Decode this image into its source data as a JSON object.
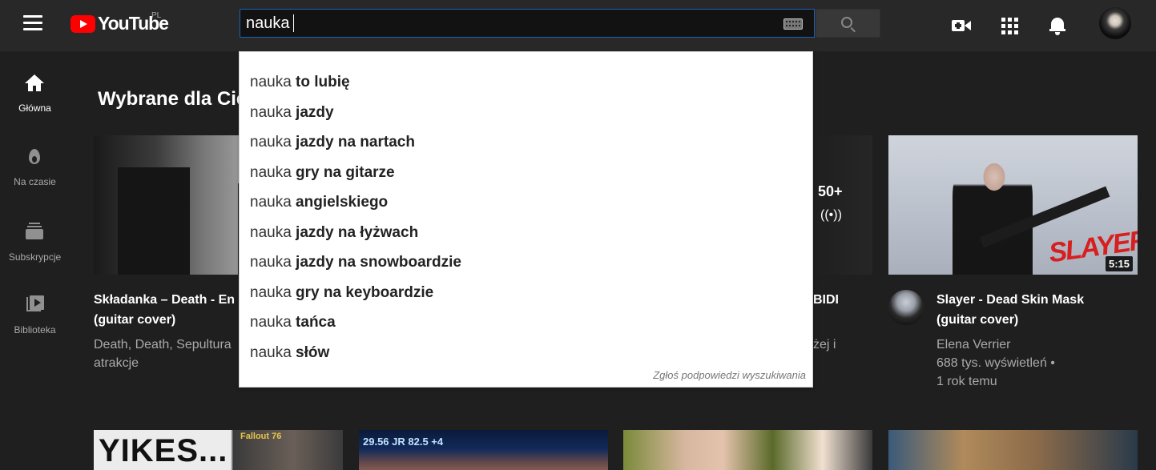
{
  "header": {
    "logo_text": "YouTube",
    "logo_country": "PL",
    "search_value": "nauka",
    "search_placeholder": ""
  },
  "sidebar": {
    "items": [
      {
        "label": "Główna",
        "icon": "home-icon",
        "active": true
      },
      {
        "label": "Na czasie",
        "icon": "trending-icon",
        "active": false
      },
      {
        "label": "Subskrypcje",
        "icon": "subscriptions-icon",
        "active": false
      },
      {
        "label": "Biblioteka",
        "icon": "library-icon",
        "active": false
      }
    ]
  },
  "main": {
    "section_title": "Wybrane dla Cie",
    "videos": [
      {
        "title_line1": "Składanka – Death - En",
        "title_line2": "(guitar cover)",
        "meta_line1": "Death, Death, Sepultura",
        "meta_line2": "atrakcje"
      },
      {
        "title_partial": "BIDI",
        "meta_partial": "żej i",
        "live_count": "50+",
        "live_icon": "((•))"
      },
      {
        "title_line1": "Slayer - Dead Skin Mask",
        "title_line2": "(guitar cover)",
        "channel": "Elena Verrier",
        "views": "688 tys. wyświetleń •",
        "age": "1 rok temu",
        "duration": "5:15",
        "thumb_text": "SLAYER"
      }
    ],
    "bottom_row": {
      "thumb1_text": "YIKES...",
      "thumb1_badge": "Fallout 76",
      "thumb2_ticker": "29.56  JR 82.5  +4"
    }
  },
  "suggestions": {
    "prefix": "nauka",
    "items": [
      " to lubię",
      " jazdy",
      " jazdy na nartach",
      " gry na gitarze",
      " angielskiego",
      " jazdy na łyżwach",
      " jazdy na snowboardzie",
      " gry na keyboardzie",
      " tańca",
      " słów"
    ],
    "report_label": "Zgłoś podpowiedzi wyszukiwania"
  },
  "colors": {
    "brand_red": "#ff0000",
    "header_bg": "#282828",
    "page_bg": "#1f1f1f",
    "focus_blue": "#1c62b9"
  }
}
